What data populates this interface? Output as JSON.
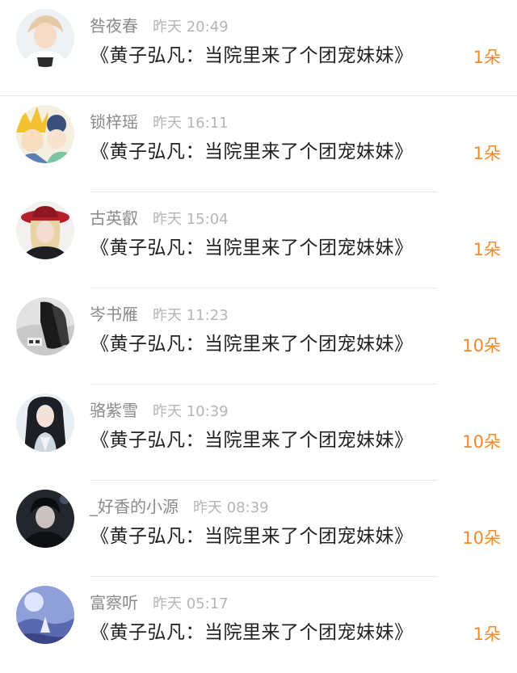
{
  "gifts": [
    {
      "name": "咎夜春",
      "time": "昨天 20:49",
      "title": "《黄子弘凡：当院里来了个团宠妹妹》",
      "count": "1朵",
      "avatar": "avatar-boy-icon"
    },
    {
      "name": "锁梓瑶",
      "time": "昨天 16:11",
      "title": "《黄子弘凡：当院里来了个团宠妹妹》",
      "count": "1朵",
      "avatar": "avatar-anime-icon"
    },
    {
      "name": "古英叡",
      "time": "昨天 15:04",
      "title": "《黄子弘凡：当院里来了个团宠妹妹》",
      "count": "1朵",
      "avatar": "avatar-hat-icon"
    },
    {
      "name": "岑书雁",
      "time": "昨天 11:23",
      "title": "《黄子弘凡：当院里来了个团宠妹妹》",
      "count": "10朵",
      "avatar": "avatar-ink-icon"
    },
    {
      "name": "骆紫雪",
      "time": "昨天 10:39",
      "title": "《黄子弘凡：当院里来了个团宠妹妹》",
      "count": "10朵",
      "avatar": "avatar-ancient-icon"
    },
    {
      "name": "_好香的小源",
      "time": "昨天 08:39",
      "title": "《黄子弘凡：当院里来了个团宠妹妹》",
      "count": "10朵",
      "avatar": "avatar-dark-icon"
    },
    {
      "name": "富察听",
      "time": "昨天 05:17",
      "title": "《黄子弘凡：当院里来了个团宠妹妹》",
      "count": "1朵",
      "avatar": "avatar-scene-icon"
    }
  ],
  "colors": {
    "accent": "#f08a2c",
    "name": "#8a8a8a",
    "time": "#b5b5b5",
    "title": "#222222",
    "divider": "#ececec"
  }
}
